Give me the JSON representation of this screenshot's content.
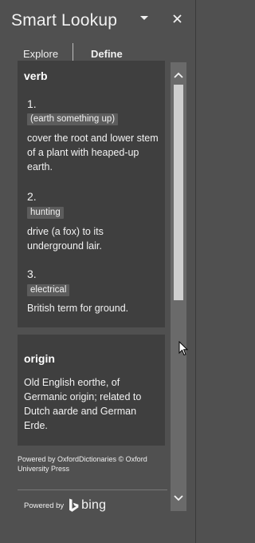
{
  "header": {
    "title": "Smart Lookup"
  },
  "tabs": [
    {
      "label": "Explore"
    },
    {
      "label": "Define"
    }
  ],
  "verb_card": {
    "heading": "verb",
    "senses": [
      {
        "number": "1.",
        "tag": "(earth something up)",
        "definition": "cover the root and lower stem of a plant with heaped-up earth."
      },
      {
        "number": "2.",
        "tag": "hunting",
        "definition": "drive (a fox) to its underground lair."
      },
      {
        "number": "3.",
        "tag": "electrical",
        "definition": "British term for ground."
      }
    ]
  },
  "origin_card": {
    "heading": "origin",
    "text": "Old English eorthe, of Germanic origin; related to Dutch aarde and German Erde."
  },
  "footer": {
    "credit": "Powered by OxfordDictionaries © Oxford University Press",
    "powered_label": "Powered by",
    "bing_label": "bing"
  },
  "colors": {
    "pane_bg": "#505050",
    "card_bg": "#3f3f3f",
    "tag_bg": "#5c5c5c",
    "scrollbar": "#6a6a6a",
    "thumb": "#cfcfcf"
  },
  "icons": [
    "chevron-down-icon",
    "close-icon",
    "scroll-up-icon",
    "scroll-down-icon",
    "bing-logo-icon",
    "mouse-pointer-icon"
  ],
  "scroll": {
    "position": "top"
  }
}
